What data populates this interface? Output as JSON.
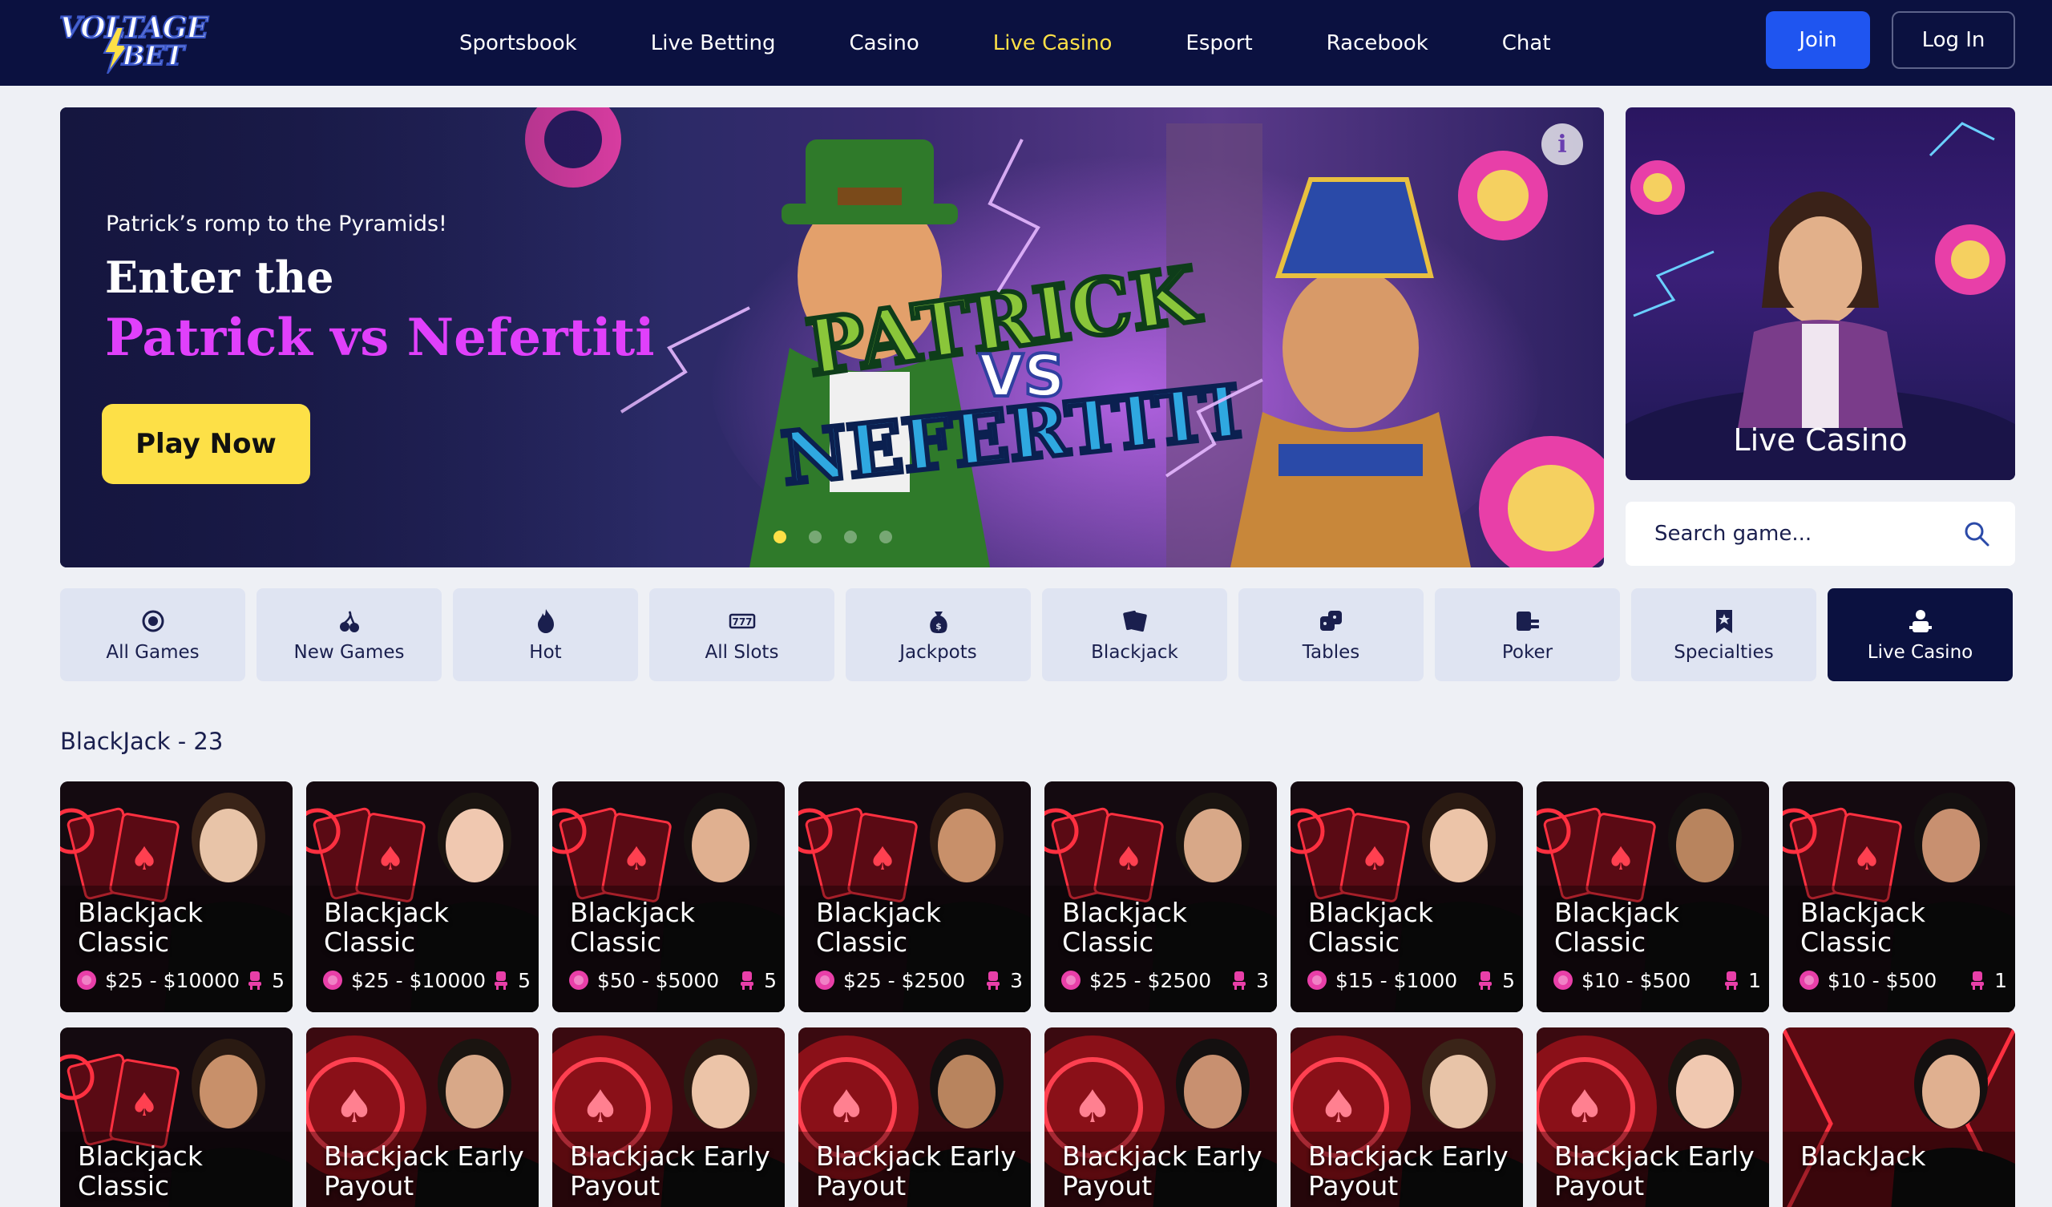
{
  "header": {
    "logo": {
      "line1": "VOLTAGE",
      "line2": "BET"
    },
    "nav": [
      {
        "label": "Sportsbook",
        "active": false
      },
      {
        "label": "Live Betting",
        "active": false
      },
      {
        "label": "Casino",
        "active": false
      },
      {
        "label": "Live Casino",
        "active": true
      },
      {
        "label": "Esport",
        "active": false
      },
      {
        "label": "Racebook",
        "active": false
      },
      {
        "label": "Chat",
        "active": false
      }
    ],
    "join_label": "Join",
    "login_label": "Log In"
  },
  "hero": {
    "subtitle": "Patrick’s romp to the Pyramids!",
    "title_line1": "Enter the",
    "title_line2": "Patrick vs Nefertiti",
    "cta_label": "Play Now",
    "info_label": "i",
    "slides_count": 4,
    "active_slide": 1,
    "art_text": "PATRICK VS NEFERTITI"
  },
  "live_promo": {
    "label": "Live Casino"
  },
  "search": {
    "placeholder": "Search game..."
  },
  "categories": [
    {
      "label": "All Games",
      "icon": "all-games-icon",
      "active": false
    },
    {
      "label": "New Games",
      "icon": "cherries-icon",
      "active": false
    },
    {
      "label": "Hot",
      "icon": "flame-icon",
      "active": false
    },
    {
      "label": "All Slots",
      "icon": "slots-777-icon",
      "active": false
    },
    {
      "label": "Jackpots",
      "icon": "money-bag-icon",
      "active": false
    },
    {
      "label": "Blackjack",
      "icon": "cards-icon",
      "active": false
    },
    {
      "label": "Tables",
      "icon": "dice-icon",
      "active": false
    },
    {
      "label": "Poker",
      "icon": "poker-icon",
      "active": false
    },
    {
      "label": "Specialties",
      "icon": "star-bookmark-icon",
      "active": false
    },
    {
      "label": "Live Casino",
      "icon": "dealer-icon",
      "active": true
    }
  ],
  "section": {
    "title": "BlackJack - 23"
  },
  "games_row1": [
    {
      "name": "Blackjack Classic",
      "limits": "$25 - $10000",
      "seats": "5"
    },
    {
      "name": "Blackjack Classic",
      "limits": "$25 - $10000",
      "seats": "5"
    },
    {
      "name": "Blackjack Classic",
      "limits": "$50 - $5000",
      "seats": "5"
    },
    {
      "name": "Blackjack Classic",
      "limits": "$25 - $2500",
      "seats": "3"
    },
    {
      "name": "Blackjack Classic",
      "limits": "$25 - $2500",
      "seats": "3"
    },
    {
      "name": "Blackjack Classic",
      "limits": "$15 - $1000",
      "seats": "5"
    },
    {
      "name": "Blackjack Classic",
      "limits": "$10 - $500",
      "seats": "1"
    },
    {
      "name": "Blackjack Classic",
      "limits": "$10 - $500",
      "seats": "1"
    }
  ],
  "games_row2": [
    {
      "name": "Blackjack Classic"
    },
    {
      "name": "Blackjack Early Payout"
    },
    {
      "name": "Blackjack Early Payout"
    },
    {
      "name": "Blackjack Early Payout"
    },
    {
      "name": "Blackjack Early Payout"
    },
    {
      "name": "Blackjack Early Payout"
    },
    {
      "name": "Blackjack Early Payout"
    },
    {
      "name": "BlackJack"
    }
  ],
  "colors": {
    "header_bg": "#0b1140",
    "nav_active": "#fde047",
    "join_bg": "#1f55f0",
    "play_bg": "#fde047",
    "hero_title_accent": "#e040fb",
    "category_bg": "#dfe4f2",
    "category_active_bg": "#0b1140",
    "chip_pink": "#e83fa8"
  }
}
